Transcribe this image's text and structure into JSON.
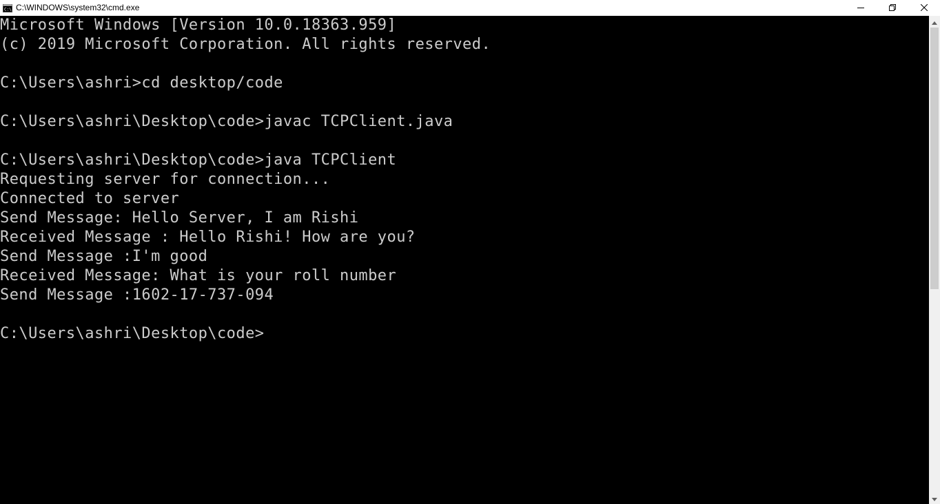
{
  "window": {
    "title": "C:\\WINDOWS\\system32\\cmd.exe",
    "icon": "cmd-icon",
    "controls": {
      "minimize_icon": "minimize-icon",
      "restore_icon": "restore-icon",
      "close_icon": "close-icon"
    }
  },
  "console": {
    "background": "#000000",
    "foreground": "#cccccc",
    "lines": [
      "Microsoft Windows [Version 10.0.18363.959]",
      "(c) 2019 Microsoft Corporation. All rights reserved.",
      "",
      "C:\\Users\\ashri>cd desktop/code",
      "",
      "C:\\Users\\ashri\\Desktop\\code>javac TCPClient.java",
      "",
      "C:\\Users\\ashri\\Desktop\\code>java TCPClient",
      "Requesting server for connection...",
      "Connected to server",
      "Send Message: Hello Server, I am Rishi",
      "Received Message : Hello Rishi! How are you?",
      "Send Message :I'm good",
      "Received Message: What is your roll number",
      "Send Message :1602-17-737-094",
      "",
      "C:\\Users\\ashri\\Desktop\\code>"
    ]
  }
}
